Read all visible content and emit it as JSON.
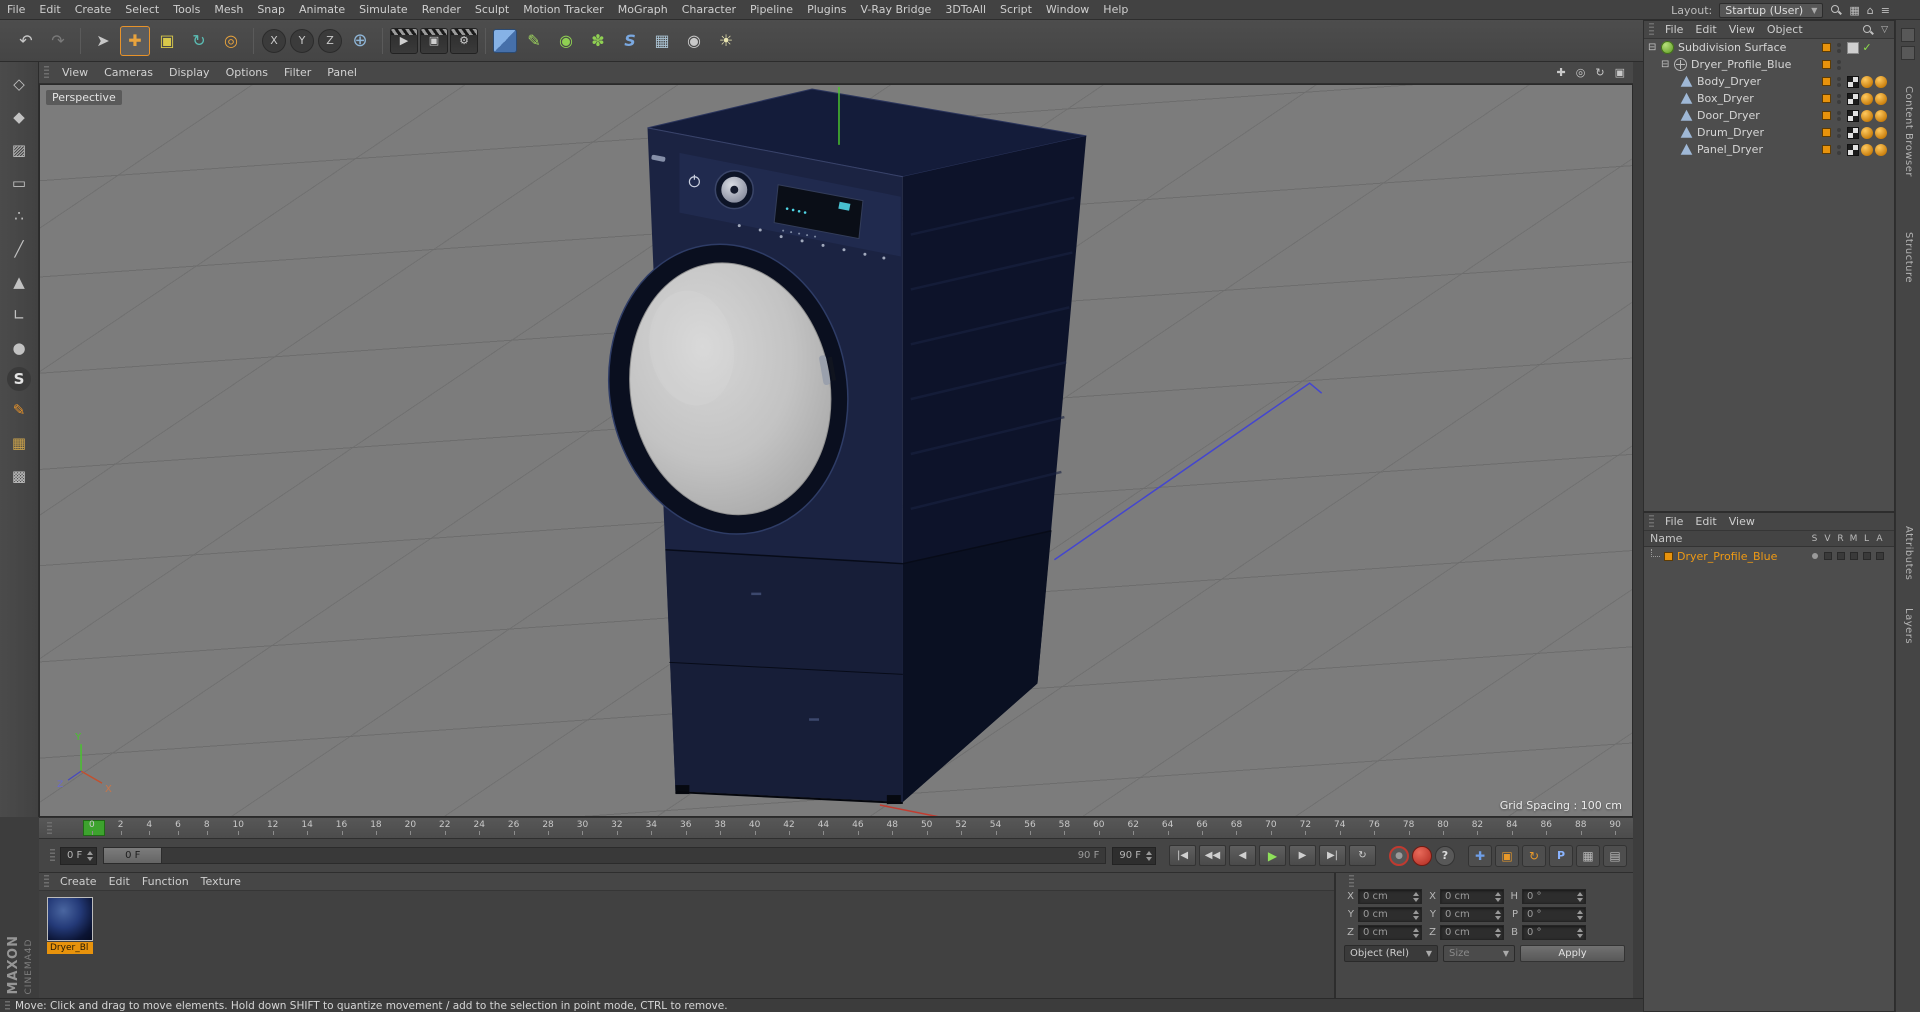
{
  "menu_bar": {
    "items": [
      "File",
      "Edit",
      "Create",
      "Select",
      "Tools",
      "Mesh",
      "Snap",
      "Animate",
      "Simulate",
      "Render",
      "Sculpt",
      "Motion Tracker",
      "MoGraph",
      "Character",
      "Pipeline",
      "Plugins",
      "V-Ray Bridge",
      "3DToAll",
      "Script",
      "Window",
      "Help"
    ],
    "layout_label": "Layout:",
    "layout_value": "Startup (User)"
  },
  "toolbar": {
    "tools": [
      {
        "name": "undo",
        "glyph": "↶",
        "kind": "plain"
      },
      {
        "name": "redo",
        "glyph": "↷",
        "kind": "disabled"
      },
      {
        "name": "separator-1",
        "kind": "divider"
      },
      {
        "name": "live-selection",
        "glyph": "➤",
        "kind": "plain"
      },
      {
        "name": "move-tool",
        "glyph": "✚",
        "kind": "plain",
        "state": "active"
      },
      {
        "name": "scale-tool",
        "glyph": "▣",
        "kind": "plain"
      },
      {
        "name": "rotate-tool",
        "glyph": "↻",
        "kind": "plain"
      },
      {
        "name": "last-used-tool",
        "glyph": "◎",
        "kind": "plain"
      },
      {
        "name": "separator-2",
        "kind": "divider"
      },
      {
        "name": "lock-x-axis",
        "glyph": "X",
        "kind": "axis"
      },
      {
        "name": "lock-y-axis",
        "glyph": "Y",
        "kind": "axis"
      },
      {
        "name": "lock-z-axis",
        "glyph": "Z",
        "kind": "axis"
      },
      {
        "name": "coordinate-system",
        "glyph": "⊕",
        "kind": "plain"
      },
      {
        "name": "separator-3",
        "kind": "divider"
      },
      {
        "name": "render-view",
        "glyph": "▶",
        "kind": "clapper"
      },
      {
        "name": "render-picture-viewer",
        "glyph": "▣",
        "kind": "clapper"
      },
      {
        "name": "render-settings",
        "glyph": "⚙",
        "kind": "clapper"
      },
      {
        "name": "separator-4",
        "kind": "divider"
      },
      {
        "name": "add-primitive",
        "glyph": "",
        "kind": "cube"
      },
      {
        "name": "add-spline",
        "glyph": "✎",
        "kind": "plain"
      },
      {
        "name": "add-subdivision-surface",
        "glyph": "◉",
        "kind": "plain"
      },
      {
        "name": "add-cloner",
        "glyph": "✽",
        "kind": "plain"
      },
      {
        "name": "add-deformer",
        "glyph": "S",
        "kind": "plain"
      },
      {
        "name": "add-floor",
        "glyph": "▦",
        "kind": "plain"
      },
      {
        "name": "add-camera",
        "glyph": "◉",
        "kind": "camera"
      },
      {
        "name": "add-light",
        "glyph": "☀",
        "kind": "plain"
      }
    ]
  },
  "left_toolbar": {
    "tools": [
      {
        "name": "make-editable",
        "glyph": "◇"
      },
      {
        "name": "model-mode",
        "glyph": "◆"
      },
      {
        "name": "texture-mode",
        "glyph": "▨"
      },
      {
        "name": "workplane-mode",
        "glyph": "▭"
      },
      {
        "name": "points-mode",
        "glyph": "∴"
      },
      {
        "name": "edges-mode",
        "glyph": "╱"
      },
      {
        "name": "polygons-mode",
        "glyph": "▲"
      },
      {
        "name": "enable-axis",
        "glyph": "∟"
      },
      {
        "name": "viewport-solo",
        "glyph": "●"
      },
      {
        "name": "snap-toggle",
        "glyph": "S"
      },
      {
        "name": "paint-tool",
        "glyph": "✎"
      },
      {
        "name": "locked-workplane",
        "glyph": "▦"
      },
      {
        "name": "workplane-grid",
        "glyph": "▩"
      }
    ]
  },
  "viewport": {
    "menu": [
      "View",
      "Cameras",
      "Display",
      "Options",
      "Filter",
      "Panel"
    ],
    "nav_icons": [
      {
        "name": "pan-view-icon",
        "glyph": "✚"
      },
      {
        "name": "zoom-view-icon",
        "glyph": "◎"
      },
      {
        "name": "rotate-view-icon",
        "glyph": "↻"
      },
      {
        "name": "maximize-view-icon",
        "glyph": "▣"
      }
    ],
    "camera_label": "Perspective",
    "grid_spacing_label": "Grid Spacing : 100 cm",
    "axis_labels": {
      "x": "X",
      "y": "Y",
      "z": "Z"
    }
  },
  "object_manager": {
    "menu": [
      "File",
      "Edit",
      "View",
      "Object"
    ],
    "tree": [
      {
        "label": "Subdivision Surface",
        "indent": 0,
        "icon": "subdivision-surface",
        "expand": "true",
        "tag1": "graybox",
        "tag2": "check"
      },
      {
        "label": "Dryer_Profile_Blue",
        "indent": 1,
        "icon": "null-object",
        "expand": "true"
      },
      {
        "label": "Body_Dryer",
        "indent": 2,
        "icon": "polygon-object",
        "tag1": "checker",
        "tag2": "phong",
        "tag3": "phong"
      },
      {
        "label": "Box_Dryer",
        "indent": 2,
        "icon": "polygon-object",
        "tag1": "checker",
        "tag2": "phong",
        "tag3": "phong"
      },
      {
        "label": "Door_Dryer",
        "indent": 2,
        "icon": "polygon-object",
        "tag1": "checker",
        "tag2": "phong",
        "tag3": "phong"
      },
      {
        "label": "Drum_Dryer",
        "indent": 2,
        "icon": "polygon-object",
        "tag1": "checker",
        "tag2": "phong",
        "tag3": "phong"
      },
      {
        "label": "Panel_Dryer",
        "indent": 2,
        "icon": "polygon-object",
        "tag1": "checker",
        "tag2": "phong",
        "tag3": "phong"
      }
    ]
  },
  "layer_manager": {
    "menu": [
      "File",
      "Edit",
      "View"
    ],
    "name_header": "Name",
    "columns": [
      "S",
      "V",
      "R",
      "M",
      "L",
      "A"
    ],
    "row": {
      "label": "Dryer_Profile_Blue"
    }
  },
  "timeline": {
    "ticks": [
      "0",
      "2",
      "4",
      "6",
      "8",
      "10",
      "12",
      "14",
      "16",
      "18",
      "20",
      "22",
      "24",
      "26",
      "28",
      "30",
      "32",
      "34",
      "36",
      "38",
      "40",
      "42",
      "44",
      "46",
      "48",
      "50",
      "52",
      "54",
      "56",
      "58",
      "60",
      "62",
      "64",
      "66",
      "68",
      "70",
      "72",
      "74",
      "76",
      "78",
      "80",
      "82",
      "84",
      "86",
      "88",
      "90"
    ],
    "current_frame": "0 F",
    "range_start_label": "0 F",
    "range_end_label": "90 F",
    "end_frame": "90 F",
    "controls": [
      {
        "name": "goto-start",
        "glyph": "|◀"
      },
      {
        "name": "previous-key",
        "glyph": "◀◀"
      },
      {
        "name": "previous-frame",
        "glyph": "◀"
      },
      {
        "name": "play",
        "glyph": "▶",
        "kind": "play"
      },
      {
        "name": "next-frame",
        "glyph": "▶"
      },
      {
        "name": "goto-end",
        "glyph": "▶|"
      },
      {
        "name": "play-mode",
        "glyph": "↻"
      }
    ],
    "record_buttons": [
      {
        "name": "record-keyframe",
        "glyph": "●",
        "kind": "rec-outline"
      },
      {
        "name": "autokeying",
        "glyph": "●",
        "kind": "rec-solid"
      },
      {
        "name": "help",
        "glyph": "?",
        "kind": "rec-help"
      }
    ],
    "key_buttons": [
      {
        "name": "record-position",
        "glyph": "✚",
        "kind": "kt-blue"
      },
      {
        "name": "record-scale",
        "glyph": "▣",
        "kind": "kt-orange"
      },
      {
        "name": "record-rotation",
        "glyph": "↻",
        "kind": "kt-orange"
      },
      {
        "name": "record-parameter",
        "glyph": "P",
        "kind": "kt-bluecirc"
      },
      {
        "name": "record-pla",
        "glyph": "▦",
        "kind": "kt-gray"
      },
      {
        "name": "keyframe-selection",
        "glyph": "▤",
        "kind": "kt-gray"
      }
    ]
  },
  "material_manager": {
    "menu": [
      "Create",
      "Edit",
      "Function",
      "Texture"
    ],
    "materials": [
      {
        "label": "Dryer_Bl"
      }
    ]
  },
  "coordinates": {
    "rows": [
      {
        "l1": "X",
        "v1": "0 cm",
        "l2": "X",
        "v2": "0 cm",
        "l3": "H",
        "v3": "0 °"
      },
      {
        "l1": "Y",
        "v1": "0 cm",
        "l2": "Y",
        "v2": "0 cm",
        "l3": "P",
        "v3": "0 °"
      },
      {
        "l1": "Z",
        "v1": "0 cm",
        "l2": "Z",
        "v2": "0 cm",
        "l3": "B",
        "v3": "0 °"
      }
    ],
    "object_mode": "Object (Rel)",
    "size_mode": "Size",
    "apply_label": "Apply"
  },
  "status_bar": {
    "text": "Move: Click and drag to move elements. Hold down SHIFT to quantize movement / add to the selection in point mode, CTRL to remove."
  },
  "branding": {
    "maxon": "MAXON",
    "cinema": "CINEMA4D"
  },
  "right_tabs": [
    "Content Browser",
    "Structure",
    "Attributes",
    "Layers"
  ],
  "colors": {
    "accent_orange": "#e8930c",
    "axis_green": "#49c32d",
    "axis_red": "#c23c30",
    "axis_blue": "#4446cf",
    "viewport_gray": "#7c7c7c",
    "dryer_navy": "#1a2240"
  }
}
